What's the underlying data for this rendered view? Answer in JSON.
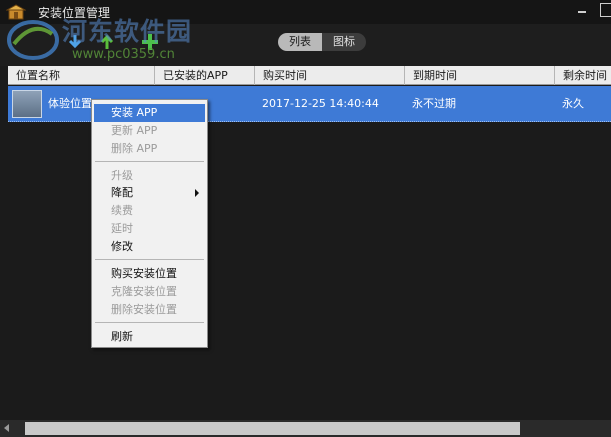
{
  "window": {
    "title": "安装位置管理"
  },
  "watermark": {
    "title": "河东软件园",
    "url": "www.pc0359.cn"
  },
  "view_toggle": {
    "list_label": "列表",
    "icon_label": "图标",
    "selected": "列表"
  },
  "table": {
    "columns": [
      "位置名称",
      "已安装的APP",
      "购买时间",
      "到期时间",
      "剩余时间"
    ],
    "rows": [
      {
        "name": "体验位置",
        "installed_app": "",
        "purchase_time": "2017-12-25 14:40:44",
        "expire_time": "永不过期",
        "remaining": "永久"
      }
    ]
  },
  "context_menu": {
    "items": [
      {
        "label": "安装 APP",
        "enabled": true,
        "highlighted": true
      },
      {
        "label": "更新 APP",
        "enabled": false
      },
      {
        "label": "删除 APP",
        "enabled": false
      },
      {
        "label": "升级",
        "enabled": false
      },
      {
        "label": "降配",
        "enabled": true,
        "submenu": true
      },
      {
        "label": "续费",
        "enabled": false
      },
      {
        "label": "延时",
        "enabled": false
      },
      {
        "label": "修改",
        "enabled": true
      },
      {
        "label": "购买安装位置",
        "enabled": true
      },
      {
        "label": "克隆安装位置",
        "enabled": false
      },
      {
        "label": "删除安装位置",
        "enabled": false
      },
      {
        "label": "刷新",
        "enabled": true
      }
    ]
  },
  "colors": {
    "selection": "#3e7ad6",
    "background": "#1b1b1b",
    "header": "#ececec"
  },
  "icons": [
    "app-icon",
    "download-icon",
    "upload-icon",
    "add-icon",
    "minimize-icon",
    "maximize-icon"
  ]
}
